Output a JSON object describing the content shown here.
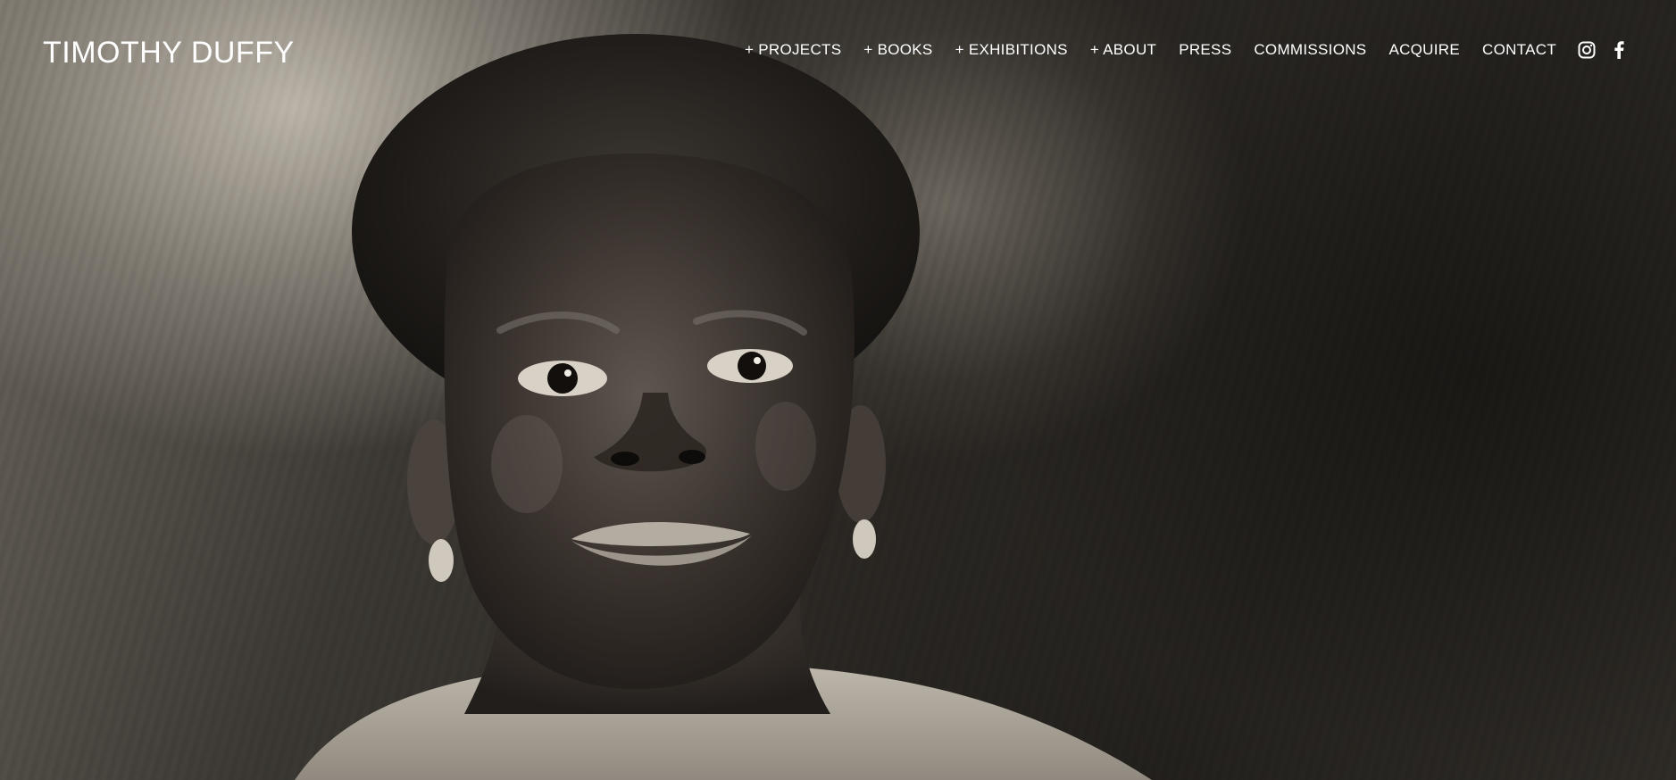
{
  "header": {
    "site_title": "TIMOTHY DUFFY"
  },
  "nav": {
    "items": [
      {
        "label": "+ PROJECTS"
      },
      {
        "label": "+ BOOKS"
      },
      {
        "label": "+ EXHIBITIONS"
      },
      {
        "label": "+ ABOUT"
      },
      {
        "label": "PRESS"
      },
      {
        "label": "COMMISSIONS"
      },
      {
        "label": "ACQUIRE"
      },
      {
        "label": "CONTACT"
      }
    ],
    "social": [
      {
        "icon": "instagram-icon"
      },
      {
        "icon": "facebook-icon"
      }
    ]
  },
  "colors": {
    "nav_text": "#ffffff",
    "photo_tone": "#2a2723"
  }
}
